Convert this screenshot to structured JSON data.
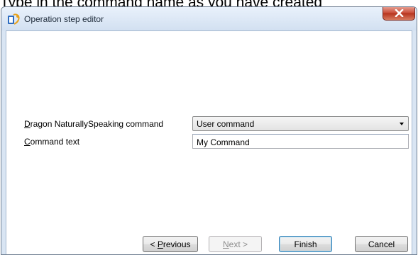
{
  "caption": "Type in the command name as you have created",
  "window": {
    "title": "Operation step editor",
    "close_glyph": "x"
  },
  "form": {
    "command_label_key": "D",
    "command_label_rest": "ragon NaturallySpeaking command",
    "command_value": "User command",
    "text_label_key": "C",
    "text_label_rest": "ommand text",
    "text_value": "My Command"
  },
  "buttons": {
    "previous_prefix": "< ",
    "previous_key": "P",
    "previous_rest": "revious",
    "next_key": "N",
    "next_rest": "ext >",
    "finish": "Finish",
    "cancel": "Cancel"
  },
  "icons": {
    "app": "dragon-app-icon",
    "close": "close-icon",
    "dropdown": "chevron-down-icon"
  },
  "colors": {
    "titlebar": "#d2e0f1",
    "close_button": "#c94b36",
    "focus_border": "#3c7fb1"
  }
}
